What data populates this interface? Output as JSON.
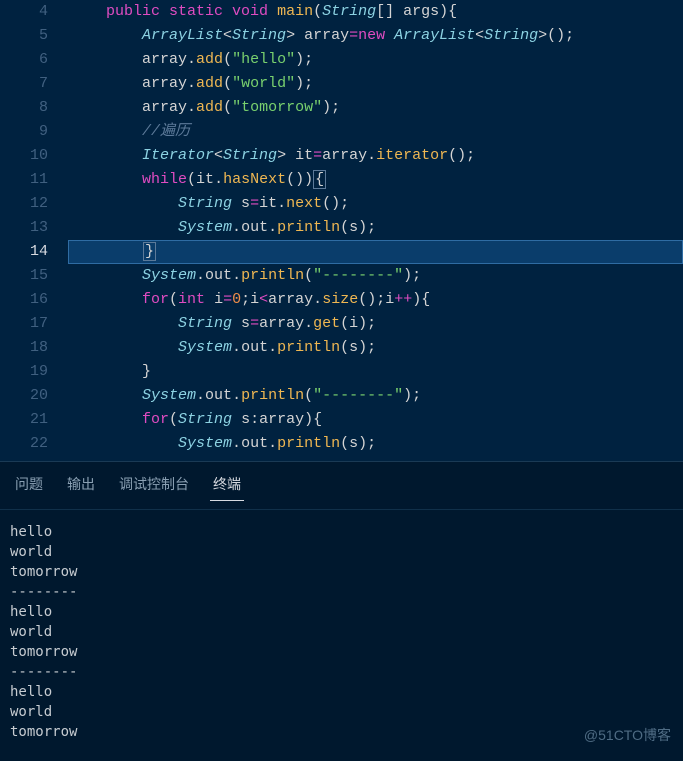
{
  "lines": [
    {
      "num": 4,
      "indent": 2,
      "tokens": [
        {
          "t": "public ",
          "c": "kw"
        },
        {
          "t": "static ",
          "c": "kw"
        },
        {
          "t": "void ",
          "c": "kw"
        },
        {
          "t": "main",
          "c": "fn"
        },
        {
          "t": "(",
          "c": "pun"
        },
        {
          "t": "String",
          "c": "type"
        },
        {
          "t": "[] ",
          "c": "pun"
        },
        {
          "t": "args",
          "c": "var"
        },
        {
          "t": "){",
          "c": "pun"
        }
      ]
    },
    {
      "num": 5,
      "indent": 3,
      "tokens": [
        {
          "t": "ArrayList",
          "c": "type"
        },
        {
          "t": "<",
          "c": "pun"
        },
        {
          "t": "String",
          "c": "type"
        },
        {
          "t": "> ",
          "c": "pun"
        },
        {
          "t": "array",
          "c": "var"
        },
        {
          "t": "=",
          "c": "op"
        },
        {
          "t": "new ",
          "c": "kw"
        },
        {
          "t": "ArrayList",
          "c": "type"
        },
        {
          "t": "<",
          "c": "pun"
        },
        {
          "t": "String",
          "c": "type"
        },
        {
          "t": ">();",
          "c": "pun"
        }
      ]
    },
    {
      "num": 6,
      "indent": 3,
      "tokens": [
        {
          "t": "array",
          "c": "var"
        },
        {
          "t": ".",
          "c": "pun"
        },
        {
          "t": "add",
          "c": "fn"
        },
        {
          "t": "(",
          "c": "pun"
        },
        {
          "t": "\"hello\"",
          "c": "str"
        },
        {
          "t": ");",
          "c": "pun"
        }
      ]
    },
    {
      "num": 7,
      "indent": 3,
      "tokens": [
        {
          "t": "array",
          "c": "var"
        },
        {
          "t": ".",
          "c": "pun"
        },
        {
          "t": "add",
          "c": "fn"
        },
        {
          "t": "(",
          "c": "pun"
        },
        {
          "t": "\"world\"",
          "c": "str"
        },
        {
          "t": ");",
          "c": "pun"
        }
      ]
    },
    {
      "num": 8,
      "indent": 3,
      "tokens": [
        {
          "t": "array",
          "c": "var"
        },
        {
          "t": ".",
          "c": "pun"
        },
        {
          "t": "add",
          "c": "fn"
        },
        {
          "t": "(",
          "c": "pun"
        },
        {
          "t": "\"tomorrow\"",
          "c": "str"
        },
        {
          "t": ");",
          "c": "pun"
        }
      ]
    },
    {
      "num": 9,
      "indent": 3,
      "tokens": [
        {
          "t": "//遍历",
          "c": "cm"
        }
      ]
    },
    {
      "num": 10,
      "indent": 3,
      "tokens": [
        {
          "t": "Iterator",
          "c": "type"
        },
        {
          "t": "<",
          "c": "pun"
        },
        {
          "t": "String",
          "c": "type"
        },
        {
          "t": "> ",
          "c": "pun"
        },
        {
          "t": "it",
          "c": "var"
        },
        {
          "t": "=",
          "c": "op"
        },
        {
          "t": "array",
          "c": "var"
        },
        {
          "t": ".",
          "c": "pun"
        },
        {
          "t": "iterator",
          "c": "fn"
        },
        {
          "t": "();",
          "c": "pun"
        }
      ]
    },
    {
      "num": 11,
      "indent": 3,
      "tokens": [
        {
          "t": "while",
          "c": "kw"
        },
        {
          "t": "(",
          "c": "pun"
        },
        {
          "t": "it",
          "c": "var"
        },
        {
          "t": ".",
          "c": "pun"
        },
        {
          "t": "hasNext",
          "c": "fn"
        },
        {
          "t": "())",
          "c": "pun"
        },
        {
          "t": "{",
          "c": "pun box"
        }
      ]
    },
    {
      "num": 12,
      "indent": 4,
      "tokens": [
        {
          "t": "String ",
          "c": "type"
        },
        {
          "t": "s",
          "c": "var"
        },
        {
          "t": "=",
          "c": "op"
        },
        {
          "t": "it",
          "c": "var"
        },
        {
          "t": ".",
          "c": "pun"
        },
        {
          "t": "next",
          "c": "fn"
        },
        {
          "t": "();",
          "c": "pun"
        }
      ]
    },
    {
      "num": 13,
      "indent": 4,
      "tokens": [
        {
          "t": "System",
          "c": "type"
        },
        {
          "t": ".",
          "c": "pun"
        },
        {
          "t": "out",
          "c": "var"
        },
        {
          "t": ".",
          "c": "pun"
        },
        {
          "t": "println",
          "c": "fn"
        },
        {
          "t": "(",
          "c": "pun"
        },
        {
          "t": "s",
          "c": "var"
        },
        {
          "t": ");",
          "c": "pun"
        }
      ]
    },
    {
      "num": 14,
      "indent": 3,
      "highlight": true,
      "tokens": [
        {
          "t": "}",
          "c": "pun box"
        }
      ]
    },
    {
      "num": 15,
      "indent": 3,
      "tokens": [
        {
          "t": "System",
          "c": "type"
        },
        {
          "t": ".",
          "c": "pun"
        },
        {
          "t": "out",
          "c": "var"
        },
        {
          "t": ".",
          "c": "pun"
        },
        {
          "t": "println",
          "c": "fn"
        },
        {
          "t": "(",
          "c": "pun"
        },
        {
          "t": "\"--------\"",
          "c": "str"
        },
        {
          "t": ");",
          "c": "pun"
        }
      ]
    },
    {
      "num": 16,
      "indent": 3,
      "tokens": [
        {
          "t": "for",
          "c": "kw"
        },
        {
          "t": "(",
          "c": "pun"
        },
        {
          "t": "int ",
          "c": "kw"
        },
        {
          "t": "i",
          "c": "var"
        },
        {
          "t": "=",
          "c": "op"
        },
        {
          "t": "0",
          "c": "num"
        },
        {
          "t": ";",
          "c": "pun"
        },
        {
          "t": "i",
          "c": "var"
        },
        {
          "t": "<",
          "c": "op"
        },
        {
          "t": "array",
          "c": "var"
        },
        {
          "t": ".",
          "c": "pun"
        },
        {
          "t": "size",
          "c": "fn"
        },
        {
          "t": "();",
          "c": "pun"
        },
        {
          "t": "i",
          "c": "var"
        },
        {
          "t": "++",
          "c": "op"
        },
        {
          "t": "){",
          "c": "pun"
        }
      ]
    },
    {
      "num": 17,
      "indent": 4,
      "tokens": [
        {
          "t": "String ",
          "c": "type"
        },
        {
          "t": "s",
          "c": "var"
        },
        {
          "t": "=",
          "c": "op"
        },
        {
          "t": "array",
          "c": "var"
        },
        {
          "t": ".",
          "c": "pun"
        },
        {
          "t": "get",
          "c": "fn"
        },
        {
          "t": "(",
          "c": "pun"
        },
        {
          "t": "i",
          "c": "var"
        },
        {
          "t": ");",
          "c": "pun"
        }
      ]
    },
    {
      "num": 18,
      "indent": 4,
      "tokens": [
        {
          "t": "System",
          "c": "type"
        },
        {
          "t": ".",
          "c": "pun"
        },
        {
          "t": "out",
          "c": "var"
        },
        {
          "t": ".",
          "c": "pun"
        },
        {
          "t": "println",
          "c": "fn"
        },
        {
          "t": "(",
          "c": "pun"
        },
        {
          "t": "s",
          "c": "var"
        },
        {
          "t": ");",
          "c": "pun"
        }
      ]
    },
    {
      "num": 19,
      "indent": 3,
      "tokens": [
        {
          "t": "}",
          "c": "pun"
        }
      ]
    },
    {
      "num": 20,
      "indent": 3,
      "tokens": [
        {
          "t": "System",
          "c": "type"
        },
        {
          "t": ".",
          "c": "pun"
        },
        {
          "t": "out",
          "c": "var"
        },
        {
          "t": ".",
          "c": "pun"
        },
        {
          "t": "println",
          "c": "fn"
        },
        {
          "t": "(",
          "c": "pun"
        },
        {
          "t": "\"--------\"",
          "c": "str"
        },
        {
          "t": ");",
          "c": "pun"
        }
      ]
    },
    {
      "num": 21,
      "indent": 3,
      "tokens": [
        {
          "t": "for",
          "c": "kw"
        },
        {
          "t": "(",
          "c": "pun"
        },
        {
          "t": "String ",
          "c": "type"
        },
        {
          "t": "s",
          "c": "var"
        },
        {
          "t": ":",
          "c": "pun"
        },
        {
          "t": "array",
          "c": "var"
        },
        {
          "t": "){",
          "c": "pun"
        }
      ]
    },
    {
      "num": 22,
      "indent": 4,
      "tokens": [
        {
          "t": "System",
          "c": "type"
        },
        {
          "t": ".",
          "c": "pun"
        },
        {
          "t": "out",
          "c": "var"
        },
        {
          "t": ".",
          "c": "pun"
        },
        {
          "t": "println",
          "c": "fn"
        },
        {
          "t": "(",
          "c": "pun"
        },
        {
          "t": "s",
          "c": "var"
        },
        {
          "t": ");",
          "c": "pun"
        }
      ]
    }
  ],
  "panel_tabs": [
    {
      "label": "问题",
      "active": false
    },
    {
      "label": "输出",
      "active": false
    },
    {
      "label": "调试控制台",
      "active": false
    },
    {
      "label": "终端",
      "active": true
    }
  ],
  "terminal_output": [
    "hello",
    "world",
    "tomorrow",
    "--------",
    "hello",
    "world",
    "tomorrow",
    "--------",
    "hello",
    "world",
    "tomorrow"
  ],
  "watermark": "@51CTO博客"
}
